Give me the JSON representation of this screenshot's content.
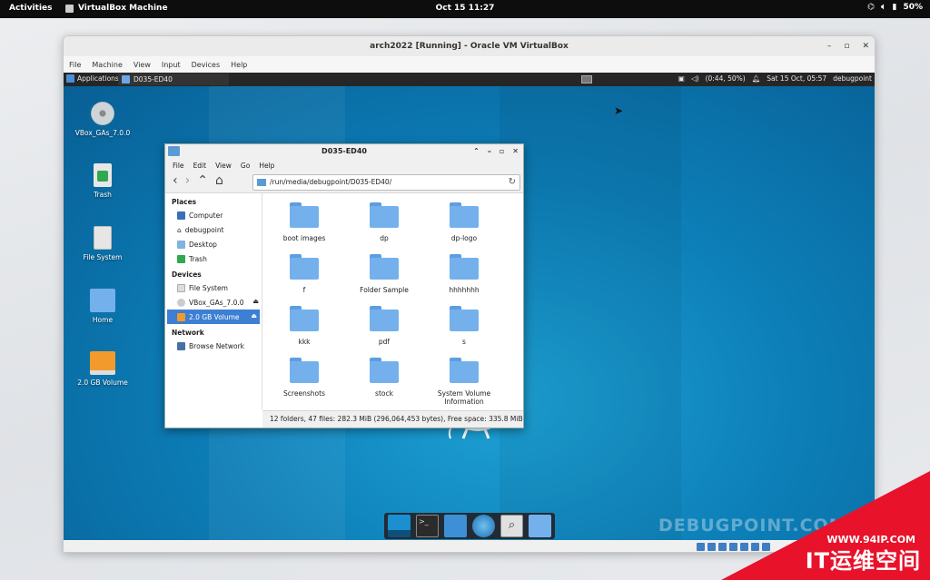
{
  "gnome": {
    "activities": "Activities",
    "app_name": "VirtualBox Machine",
    "clock": "Oct 15  11:27",
    "battery": "50%"
  },
  "vbox": {
    "title": "arch2022 [Running] - Oracle VM VirtualBox",
    "menu": [
      "File",
      "Machine",
      "View",
      "Input",
      "Devices",
      "Help"
    ]
  },
  "xfce_panel": {
    "applications": "Applications",
    "task": "D035-ED40",
    "battery": "(0:44, 50%)",
    "datetime": "Sat 15 Oct, 05:57",
    "user": "debugpoint"
  },
  "desktop_icons": [
    "VBox_GAs_7.0.0",
    "Trash",
    "File System",
    "Home",
    "2.0 GB Volume"
  ],
  "file_manager": {
    "title": "D035-ED40",
    "menu": [
      "File",
      "Edit",
      "View",
      "Go",
      "Help"
    ],
    "path": "/run/media/debugpoint/D035-ED40/",
    "sidebar": {
      "places_header": "Places",
      "places": [
        "Computer",
        "debugpoint",
        "Desktop",
        "Trash"
      ],
      "devices_header": "Devices",
      "devices": [
        "File System",
        "VBox_GAs_7.0.0",
        "2.0 GB Volume"
      ],
      "network_header": "Network",
      "network": [
        "Browse Network"
      ]
    },
    "folders": [
      "boot images",
      "dp",
      "dp-logo",
      "f",
      "Folder Sample",
      "hhhhhhh",
      "kkk",
      "pdf",
      "s",
      "Screenshots",
      "stock",
      "System Volume Information"
    ],
    "status": "12 folders, 47 files: 282.3 MiB (296,064,453 bytes), Free space: 335.8 MiB"
  },
  "watermark": "DEBUGPOINT.COM",
  "badge": {
    "url": "WWW.94IP.COM",
    "text": "IT运维空间"
  }
}
